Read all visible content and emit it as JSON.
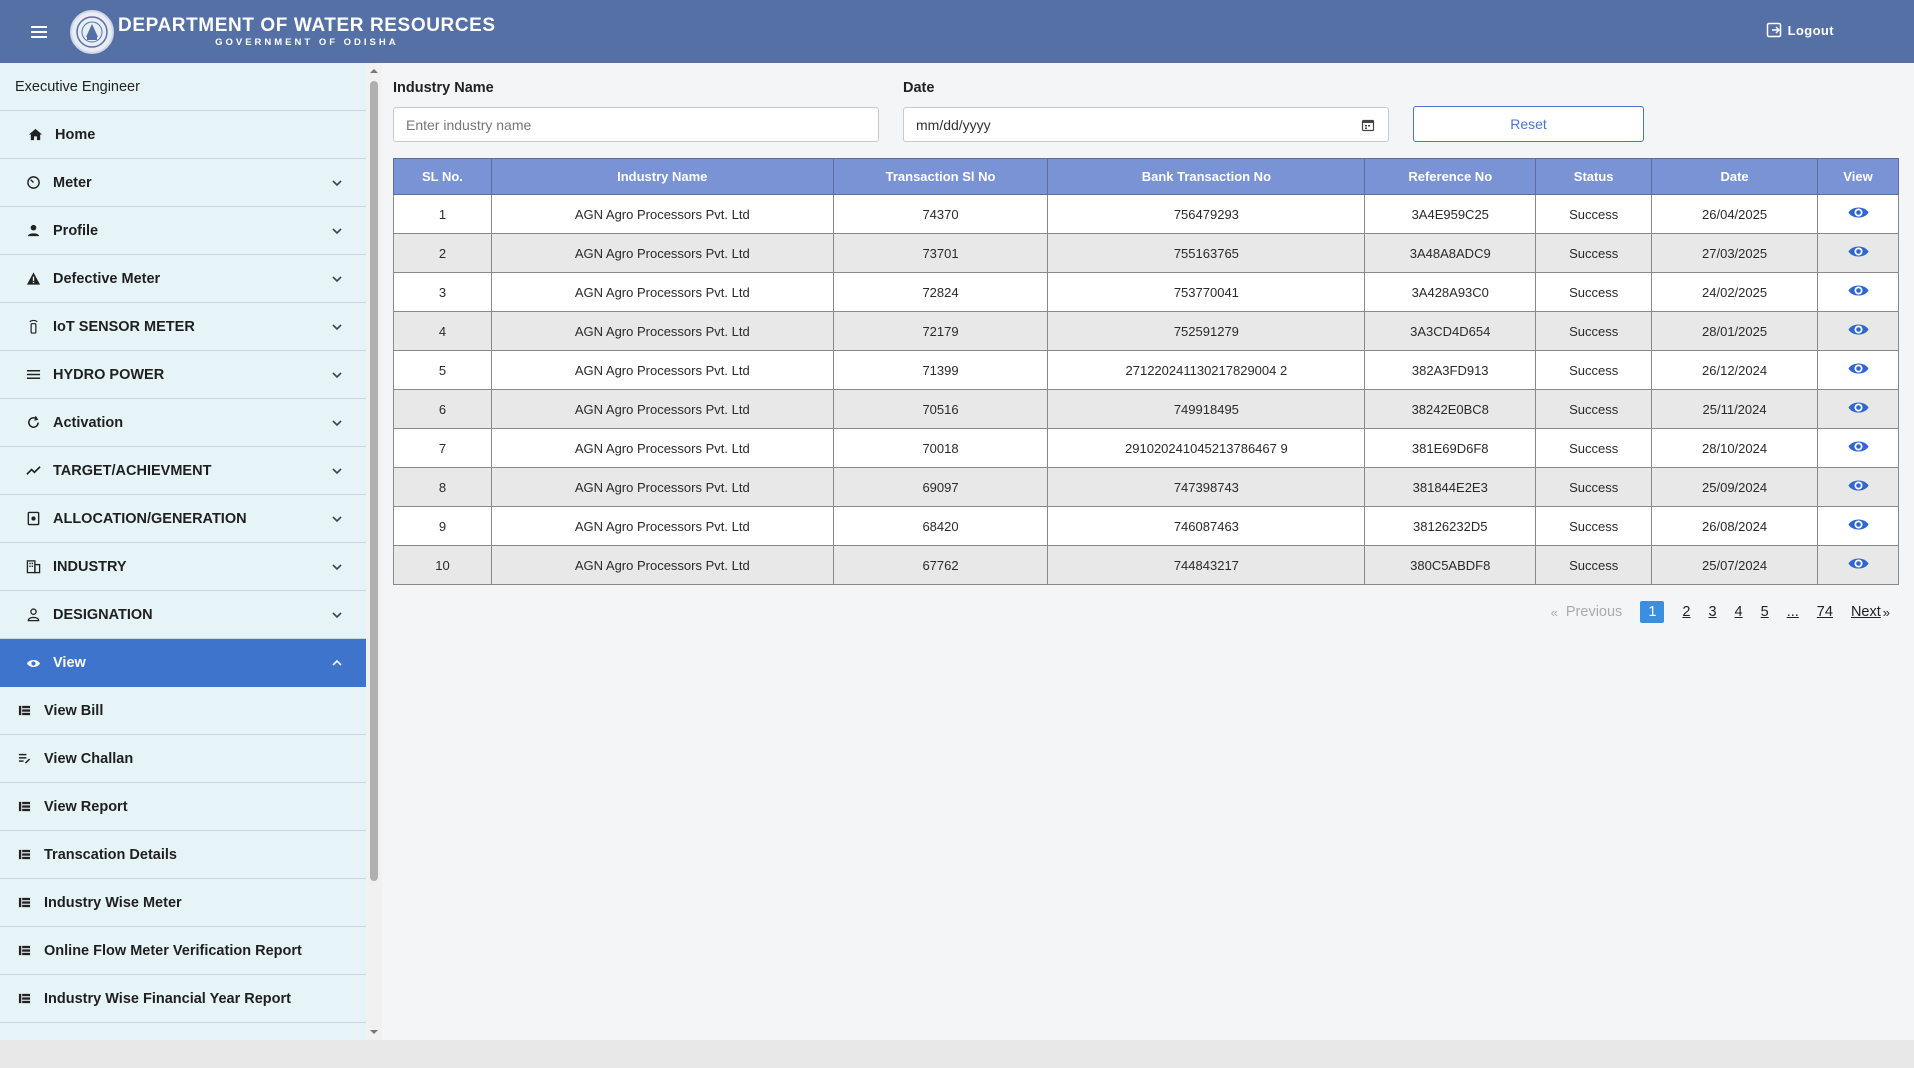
{
  "header": {
    "title": "DEPARTMENT OF WATER RESOURCES",
    "subtitle": "GOVERNMENT OF ODISHA",
    "logout_label": "Logout",
    "bg_color": "#5570a5"
  },
  "sidebar": {
    "user_role": "Executive Engineer",
    "items": [
      {
        "label": "Home",
        "icon": "home-icon"
      },
      {
        "label": "Meter",
        "icon": "gauge-icon"
      },
      {
        "label": "Profile",
        "icon": "person-icon"
      },
      {
        "label": "Defective Meter",
        "icon": "warning-icon"
      },
      {
        "label": "IoT SENSOR METER",
        "icon": "sensor-icon"
      },
      {
        "label": "HYDRO POWER",
        "icon": "waves-icon"
      },
      {
        "label": "Activation",
        "icon": "refresh-icon"
      },
      {
        "label": "TARGET/ACHIEVMENT",
        "icon": "trend-icon"
      },
      {
        "label": "ALLOCATION/GENERATION",
        "icon": "document-icon"
      },
      {
        "label": "INDUSTRY",
        "icon": "building-icon"
      },
      {
        "label": "DESIGNATION",
        "icon": "person-outline-icon"
      },
      {
        "label": "View",
        "icon": "eye-icon"
      }
    ],
    "sub_items": [
      {
        "label": "View Bill",
        "icon": "list-icon"
      },
      {
        "label": "View Challan",
        "icon": "edit-list-icon"
      },
      {
        "label": "View Report",
        "icon": "list-icon"
      },
      {
        "label": "Transcation Details",
        "icon": "list-icon"
      },
      {
        "label": "Industry Wise Meter",
        "icon": "list-icon"
      },
      {
        "label": "Online Flow Meter Verification Report",
        "icon": "list-icon"
      },
      {
        "label": "Industry Wise Financial Year Report",
        "icon": "list-icon"
      }
    ],
    "active_color": "#3f74cc"
  },
  "filters": {
    "industry_label": "Industry Name",
    "industry_placeholder": "Enter industry name",
    "industry_value": "",
    "date_label": "Date",
    "date_placeholder": "mm/dd/yyyy",
    "reset_label": "Reset"
  },
  "table": {
    "headers": [
      "SL No.",
      "Industry Name",
      "Transaction Sl No",
      "Bank Transaction No",
      "Reference No",
      "Status",
      "Date",
      "View"
    ],
    "rows": [
      {
        "sl": "1",
        "industry": "AGN Agro Processors Pvt. Ltd",
        "txn_sl": "74370",
        "bank_txn": "756479293",
        "ref": "3A4E959C25",
        "status": "Success",
        "date": "26/04/2025"
      },
      {
        "sl": "2",
        "industry": "AGN Agro Processors Pvt. Ltd",
        "txn_sl": "73701",
        "bank_txn": "755163765",
        "ref": "3A48A8ADC9",
        "status": "Success",
        "date": "27/03/2025"
      },
      {
        "sl": "3",
        "industry": "AGN Agro Processors Pvt. Ltd",
        "txn_sl": "72824",
        "bank_txn": "753770041",
        "ref": "3A428A93C0",
        "status": "Success",
        "date": "24/02/2025"
      },
      {
        "sl": "4",
        "industry": "AGN Agro Processors Pvt. Ltd",
        "txn_sl": "72179",
        "bank_txn": "752591279",
        "ref": "3A3CD4D654",
        "status": "Success",
        "date": "28/01/2025"
      },
      {
        "sl": "5",
        "industry": "AGN Agro Processors Pvt. Ltd",
        "txn_sl": "71399",
        "bank_txn": "271220241130217829004 2",
        "ref": "382A3FD913",
        "status": "Success",
        "date": "26/12/2024"
      },
      {
        "sl": "6",
        "industry": "AGN Agro Processors Pvt. Ltd",
        "txn_sl": "70516",
        "bank_txn": "749918495",
        "ref": "38242E0BC8",
        "status": "Success",
        "date": "25/11/2024"
      },
      {
        "sl": "7",
        "industry": "AGN Agro Processors Pvt. Ltd",
        "txn_sl": "70018",
        "bank_txn": "291020241045213786467 9",
        "ref": "381E69D6F8",
        "status": "Success",
        "date": "28/10/2024"
      },
      {
        "sl": "8",
        "industry": "AGN Agro Processors Pvt. Ltd",
        "txn_sl": "69097",
        "bank_txn": "747398743",
        "ref": "381844E2E3",
        "status": "Success",
        "date": "25/09/2024"
      },
      {
        "sl": "9",
        "industry": "AGN Agro Processors Pvt. Ltd",
        "txn_sl": "68420",
        "bank_txn": "746087463",
        "ref": "38126232D5",
        "status": "Success",
        "date": "26/08/2024"
      },
      {
        "sl": "10",
        "industry": "AGN Agro Processors Pvt. Ltd",
        "txn_sl": "67762",
        "bank_txn": "744843217",
        "ref": "380C5ABDF8",
        "status": "Success",
        "date": "25/07/2024"
      }
    ],
    "header_color": "#7a93d4"
  },
  "pagination": {
    "previous_label": "Previous",
    "next_label": "Next",
    "pages": [
      "1",
      "2",
      "3",
      "4",
      "5",
      "...",
      "74"
    ],
    "current": "1",
    "prev_arrow": "«",
    "next_arrow": "»"
  }
}
